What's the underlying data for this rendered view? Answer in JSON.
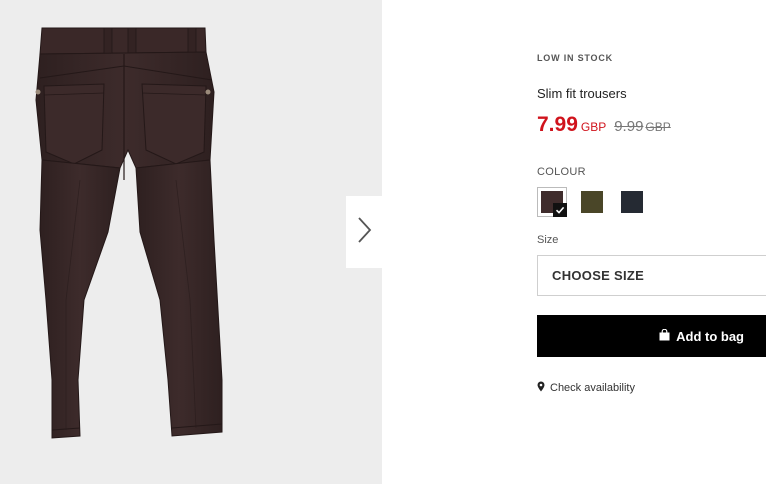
{
  "product": {
    "stock_status": "LOW IN STOCK",
    "title": "Slim fit trousers",
    "price_now": "7.99",
    "price_now_currency": "GBP",
    "price_was": "9.99",
    "price_was_currency": "GBP"
  },
  "colour": {
    "label": "COLOUR",
    "swatches": [
      {
        "name": "brown",
        "color": "#3f2c2c",
        "selected": true
      },
      {
        "name": "khaki",
        "color": "#4a4628",
        "selected": false
      },
      {
        "name": "navy",
        "color": "#252a33",
        "selected": false
      }
    ]
  },
  "size": {
    "label": "Size",
    "select_placeholder": "CHOOSE SIZE"
  },
  "actions": {
    "add_to_bag_label": "Add to bag",
    "check_availability_label": "Check availability"
  },
  "icons": {
    "next": "chevron-right-icon",
    "bag": "shopping-bag-icon",
    "location": "map-pin-icon",
    "check": "checkmark-icon"
  },
  "colors": {
    "sale_price": "#d0131c",
    "button_bg": "#000000",
    "gallery_bg": "#ededed",
    "product_fabric": "#3a2a2a"
  }
}
